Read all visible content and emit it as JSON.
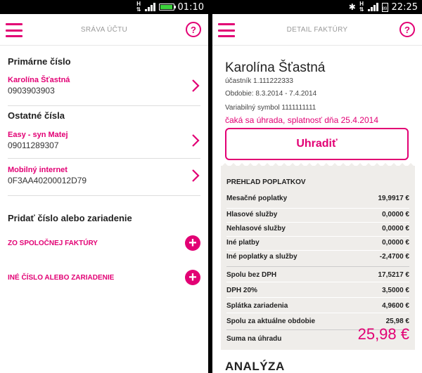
{
  "left": {
    "status": {
      "time": "01:10",
      "network": "H"
    },
    "title": "SRÁVA ÚČTU",
    "primary": {
      "heading": "Primárne číslo",
      "item": {
        "name": "Karolína Šťastná",
        "number": "0903903903"
      }
    },
    "others": {
      "heading": "Ostatné čísla",
      "items": [
        {
          "name": "Easy - syn Matej",
          "number": "09011289307"
        },
        {
          "name": "Mobilný internet",
          "number": "0F3AA40200012D79"
        }
      ]
    },
    "add": {
      "heading": "Pridať číslo alebo zariadenie",
      "items": [
        "ZO SPOLOČNEJ FAKTÚRY",
        "INÉ ČÍSLO ALEBO ZARIADENIE"
      ]
    }
  },
  "right": {
    "status": {
      "time": "22:25",
      "network": "H",
      "battery_label": "89"
    },
    "title": "DETAIL FAKTÚRY",
    "customer": "Karolína Šťastná",
    "participant": "účastník 1.111222333",
    "period": "Obdobie: 8.3.2014 - 7.4.2014",
    "vs": "Variabilný symbol 1111111111",
    "due": "čaká sa úhrada, splatnosť dňa 25.4.2014",
    "pay_label": "Uhradiť",
    "overview_title": "PREHĽAD POPLATKOV",
    "fees_a": [
      {
        "label": "Mesačné poplatky",
        "value": "19,9917 €"
      },
      {
        "label": "Hlasové služby",
        "value": "0,0000 €"
      },
      {
        "label": "Nehlasové služby",
        "value": "0,0000 €"
      },
      {
        "label": "Iné platby",
        "value": "0,0000 €"
      },
      {
        "label": "Iné poplatky a služby",
        "value": "-2,4700 €"
      }
    ],
    "fees_b": [
      {
        "label": "Spolu bez DPH",
        "value": "17,5217 €"
      },
      {
        "label": "DPH 20%",
        "value": "3,5000 €"
      },
      {
        "label": "Splátka zariadenia",
        "value": "4,9600 €"
      },
      {
        "label": "Spolu za aktuálne obdobie",
        "value": "25,98 €"
      }
    ],
    "total_label": "Suma na úhradu",
    "total_value": "25,98 €",
    "analysis_heading": "ANALÝZA"
  },
  "colors": {
    "accent": "#e20074",
    "receipt_bg": "#efedea"
  }
}
